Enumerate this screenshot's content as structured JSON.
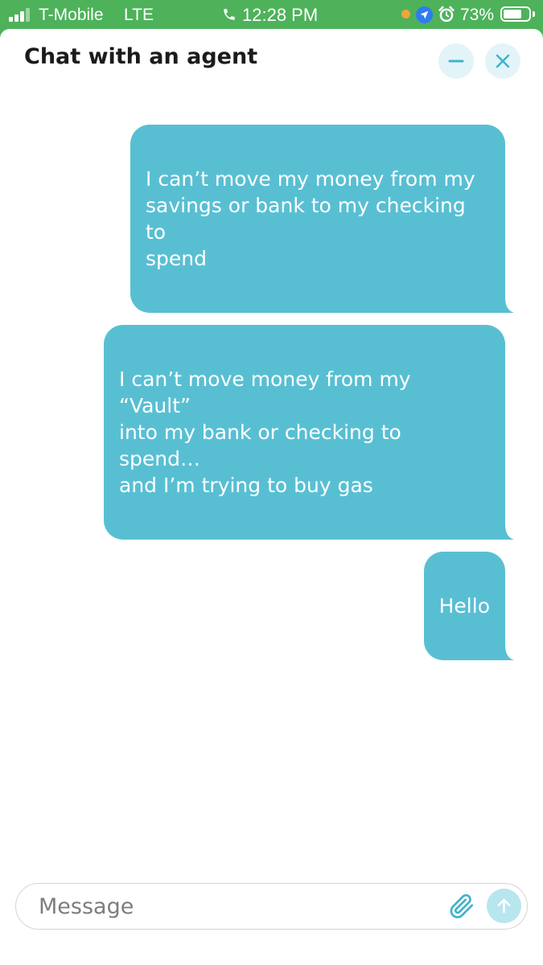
{
  "status_bar": {
    "carrier": "T-Mobile",
    "network": "LTE",
    "time": "12:28 PM",
    "battery_percent": "73%",
    "battery_level": 0.73,
    "icons": [
      "signal-icon",
      "phone-call-icon",
      "recording-dot",
      "location-arrow-icon",
      "alarm-icon",
      "battery-icon"
    ]
  },
  "chat": {
    "title": "Chat with an agent",
    "minimize_icon": "minus-icon",
    "close_icon": "close-icon",
    "messages": [
      {
        "sender": "user",
        "text": "I can’t move my money from my\nsavings or bank to my checking to\nspend"
      },
      {
        "sender": "user",
        "text": "I can’t move money from my “Vault”\ninto my bank or checking to spend…\nand I’m trying to buy gas"
      },
      {
        "sender": "user",
        "text": "Hello"
      }
    ]
  },
  "composer": {
    "placeholder": "Message",
    "value": "",
    "attach_icon": "paperclip-icon",
    "send_icon": "arrow-up-icon"
  },
  "colors": {
    "status_bar_bg": "#4db25a",
    "bubble_bg": "#58bfd3",
    "header_button_bg": "#e3f4f9",
    "accent_icon": "#3fb3cb",
    "send_button_bg": "#b7e6ef",
    "recording_dot": "#f2a33a"
  }
}
